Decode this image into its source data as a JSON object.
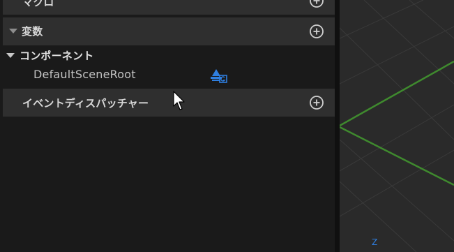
{
  "sections": {
    "macros": {
      "label": "マクロ"
    },
    "variables": {
      "label": "変数"
    },
    "components": {
      "label": "コンポーネント"
    },
    "default_scene_root": {
      "label": "DefaultSceneRoot"
    },
    "event_dispatchers": {
      "label": "イベントディスパッチャー"
    }
  },
  "viewport": {
    "axis_label": "Z"
  },
  "colors": {
    "panel_bg": "#1a1a1a",
    "header_bg": "#2f2f2f",
    "viewport_bg": "#2a2a2a",
    "grid_green": "#3f8a2e",
    "icon_blue": "#2f7fe0"
  },
  "icons": {
    "add": "plus-circle-icon",
    "expand": "triangle-down-icon",
    "scene_component": "scene-component-icon",
    "cursor": "mouse-pointer-icon"
  }
}
